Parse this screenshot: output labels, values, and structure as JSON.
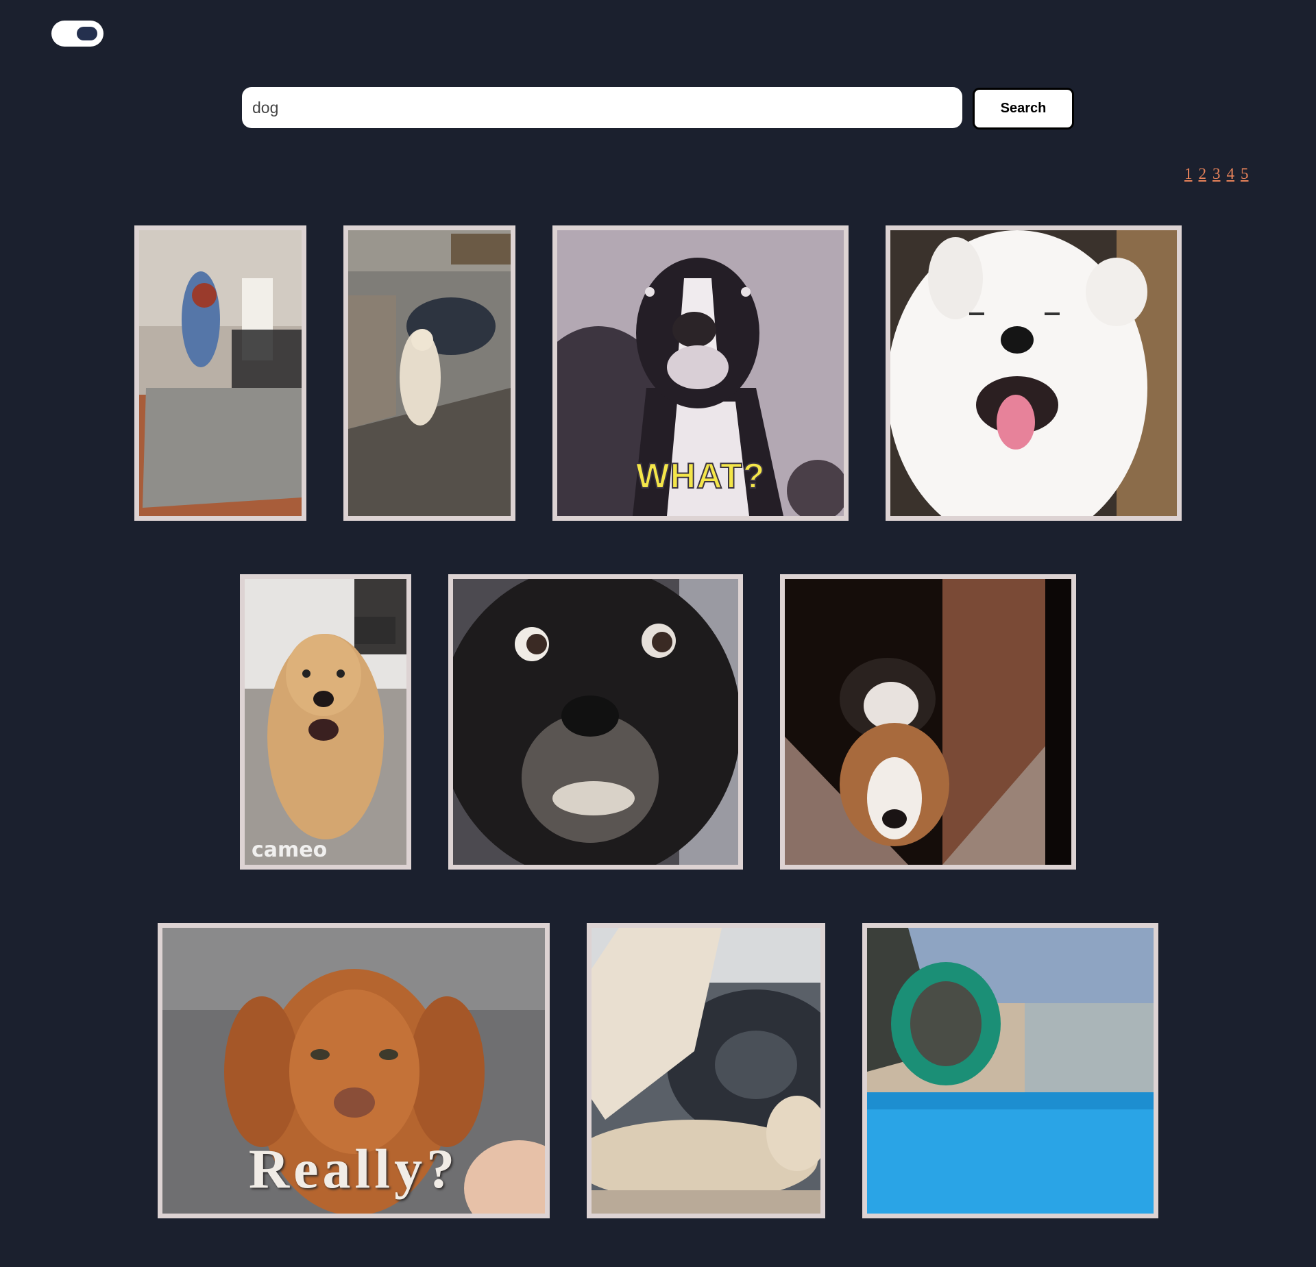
{
  "search": {
    "value": "dog",
    "button_label": "Search"
  },
  "pagination": {
    "pages": [
      "1",
      "2",
      "3",
      "4",
      "5"
    ]
  },
  "results": [
    {
      "id": "gif-1",
      "caption": ""
    },
    {
      "id": "gif-2",
      "caption": ""
    },
    {
      "id": "gif-3",
      "caption": "WHAT?"
    },
    {
      "id": "gif-4",
      "caption": ""
    },
    {
      "id": "gif-5",
      "caption": "cameo"
    },
    {
      "id": "gif-6",
      "caption": ""
    },
    {
      "id": "gif-7",
      "caption": ""
    },
    {
      "id": "gif-8",
      "caption": "Really?"
    },
    {
      "id": "gif-9",
      "caption": ""
    },
    {
      "id": "gif-10",
      "caption": ""
    }
  ],
  "colors": {
    "background": "#1b202e",
    "card_border": "#ddd3d3",
    "link": "#e8835a",
    "toggle_knob": "#24304e"
  }
}
